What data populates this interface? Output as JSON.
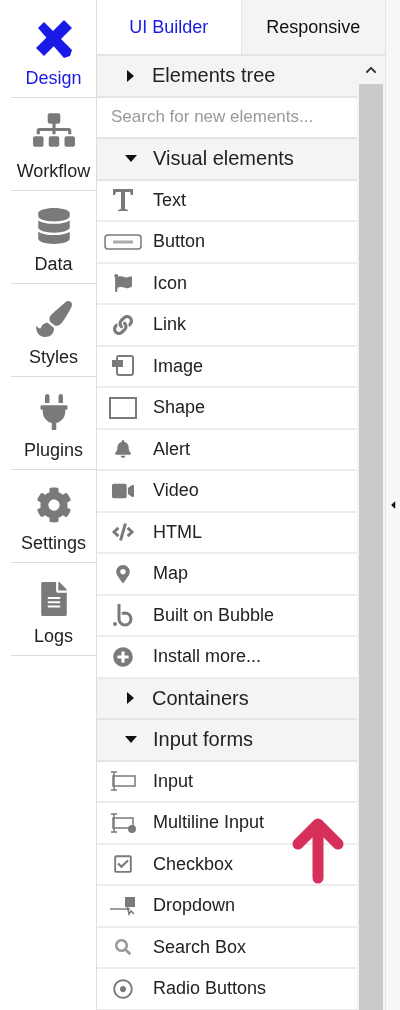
{
  "nav": [
    {
      "label": "Design",
      "kind": "design",
      "selected": true
    },
    {
      "label": "Workflow",
      "kind": "workflow",
      "selected": false
    },
    {
      "label": "Data",
      "kind": "data",
      "selected": false
    },
    {
      "label": "Styles",
      "kind": "styles",
      "selected": false
    },
    {
      "label": "Plugins",
      "kind": "plugins",
      "selected": false
    },
    {
      "label": "Settings",
      "kind": "settings",
      "selected": false
    },
    {
      "label": "Logs",
      "kind": "logs",
      "selected": false
    }
  ],
  "tabs": [
    {
      "label": "UI Builder",
      "selected": true
    },
    {
      "label": "Responsive",
      "selected": false
    }
  ],
  "tree": {
    "label": "Elements tree",
    "expanded": false
  },
  "search": {
    "placeholder": "Search for new elements..."
  },
  "sections": [
    {
      "label": "Visual elements",
      "expanded": true,
      "items": [
        {
          "label": "Text",
          "kind": "text"
        },
        {
          "label": "Button",
          "kind": "button"
        },
        {
          "label": "Icon",
          "kind": "icon"
        },
        {
          "label": "Link",
          "kind": "link"
        },
        {
          "label": "Image",
          "kind": "image"
        },
        {
          "label": "Shape",
          "kind": "shape"
        },
        {
          "label": "Alert",
          "kind": "alert"
        },
        {
          "label": "Video",
          "kind": "video"
        },
        {
          "label": "HTML",
          "kind": "html"
        },
        {
          "label": "Map",
          "kind": "map"
        },
        {
          "label": "Built on Bubble",
          "kind": "bubble"
        },
        {
          "label": "Install more...",
          "kind": "install"
        }
      ]
    },
    {
      "label": "Containers",
      "expanded": false
    },
    {
      "label": "Input forms",
      "expanded": true,
      "items": [
        {
          "label": "Input",
          "kind": "input"
        },
        {
          "label": "Multiline Input",
          "kind": "multiline"
        },
        {
          "label": "Checkbox",
          "kind": "checkbox"
        },
        {
          "label": "Dropdown",
          "kind": "dropdown"
        },
        {
          "label": "Search Box",
          "kind": "searchbox"
        },
        {
          "label": "Radio Buttons",
          "kind": "radio"
        }
      ]
    }
  ]
}
